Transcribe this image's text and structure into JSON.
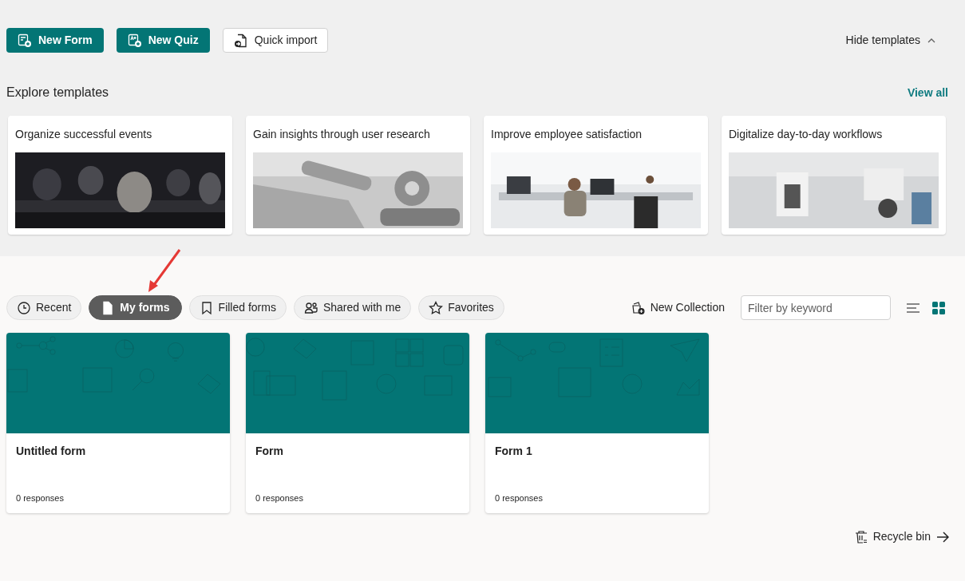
{
  "actions": [
    {
      "label": "New Form",
      "kind": "form"
    },
    {
      "label": "New Quiz",
      "kind": "quiz"
    },
    {
      "label": "Quick import",
      "kind": "import"
    }
  ],
  "hide_templates": {
    "label": "Hide templates",
    "expanded": true
  },
  "templates": {
    "title": "Explore templates",
    "view_all": "View all",
    "items": [
      {
        "title": "Organize successful events"
      },
      {
        "title": "Gain insights through user research"
      },
      {
        "title": "Improve employee satisfaction"
      },
      {
        "title": "Digitalize day-to-day workflows"
      }
    ]
  },
  "filters": [
    {
      "label": "Recent",
      "kind": "clock",
      "selected": false
    },
    {
      "label": "My forms",
      "kind": "document",
      "selected": true
    },
    {
      "label": "Filled forms",
      "kind": "bookmark",
      "selected": false
    },
    {
      "label": "Shared with me",
      "kind": "people",
      "selected": false
    },
    {
      "label": "Favorites",
      "kind": "star",
      "selected": false
    }
  ],
  "new_collection": "New Collection",
  "search": {
    "placeholder": "Filter by keyword"
  },
  "view_toggles": [
    {
      "kind": "list",
      "selected": false
    },
    {
      "kind": "grid",
      "selected": true
    }
  ],
  "forms": [
    {
      "title": "Untitled form",
      "responses": "0 responses"
    },
    {
      "title": "Form",
      "responses": "0 responses"
    },
    {
      "title": "Form 1",
      "responses": "0 responses"
    }
  ],
  "recycle_bin": "Recycle bin"
}
